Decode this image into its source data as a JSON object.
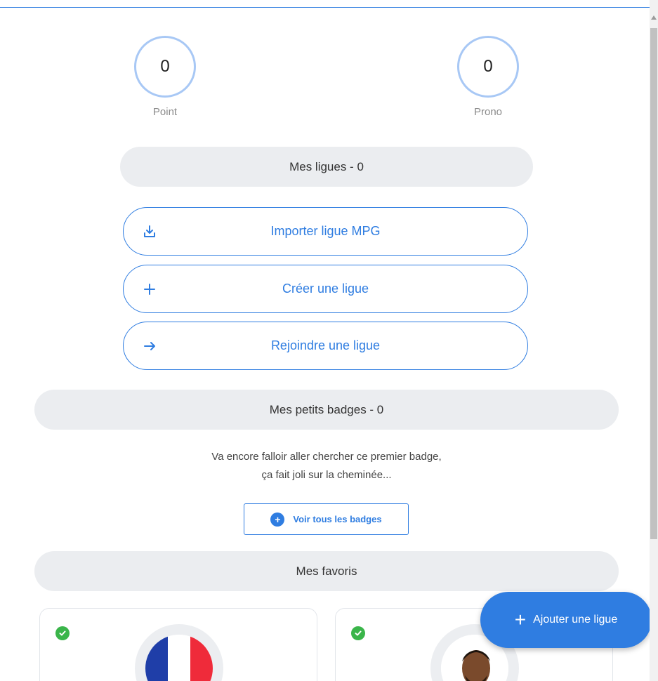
{
  "stats": {
    "points": {
      "value": "0",
      "label": "Point"
    },
    "pronos": {
      "value": "0",
      "label": "Prono"
    }
  },
  "leagues": {
    "header": "Mes ligues - 0",
    "buttons": {
      "import": {
        "label": "Importer ligue MPG",
        "icon": "download-icon"
      },
      "create": {
        "label": "Créer une ligue",
        "icon": "plus-icon"
      },
      "join": {
        "label": "Rejoindre une ligue",
        "icon": "arrow-right-icon"
      }
    }
  },
  "badges": {
    "header": "Mes petits badges - 0",
    "empty_line1": "Va encore falloir aller chercher ce premier badge,",
    "empty_line2": "ça fait joli sur la cheminée...",
    "see_all_label": "Voir tous les badges"
  },
  "favorites": {
    "header": "Mes favoris",
    "cards": [
      {
        "avatar": "france-flag",
        "checked": true
      },
      {
        "avatar": "player-photo",
        "checked": true
      }
    ]
  },
  "fab": {
    "label": "Ajouter une ligue"
  },
  "colors": {
    "accent": "#2f7de1",
    "header_bg": "#ebedf0",
    "check": "#3ab54a"
  }
}
